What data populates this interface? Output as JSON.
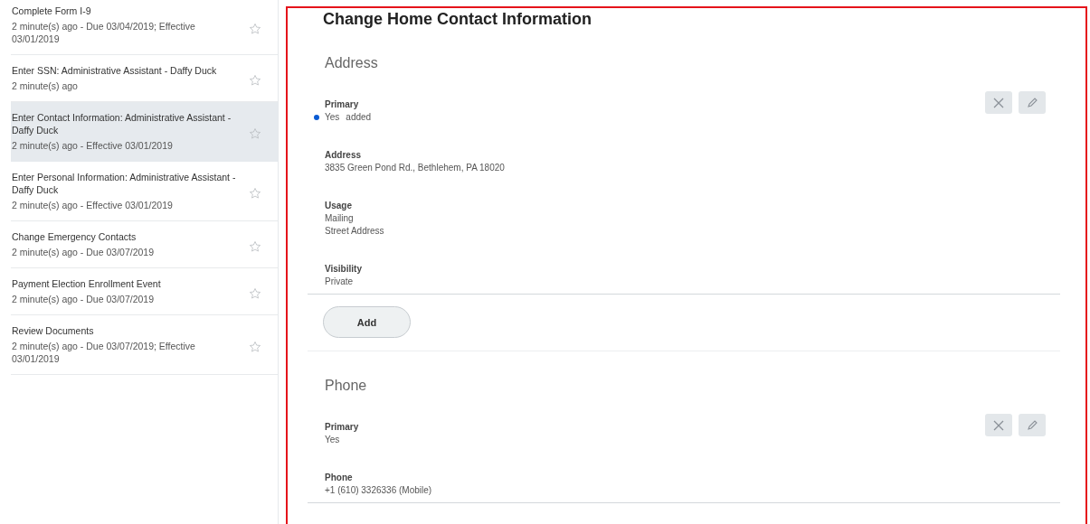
{
  "sidebar": {
    "items": [
      {
        "title": "Complete Form I-9",
        "subtitle": "2 minute(s) ago - Due 03/04/2019; Effective 03/01/2019",
        "selected": false
      },
      {
        "title": "Enter SSN: Administrative Assistant - Daffy Duck",
        "subtitle": "2 minute(s) ago",
        "selected": false
      },
      {
        "title": "Enter Contact Information: Administrative Assistant - Daffy Duck",
        "subtitle": "2 minute(s) ago - Effective 03/01/2019",
        "selected": true
      },
      {
        "title": "Enter Personal Information: Administrative Assistant - Daffy Duck",
        "subtitle": "2 minute(s) ago - Effective 03/01/2019",
        "selected": false
      },
      {
        "title": "Change Emergency Contacts",
        "subtitle": "2 minute(s) ago - Due 03/07/2019",
        "selected": false
      },
      {
        "title": "Payment Election Enrollment Event",
        "subtitle": "2 minute(s) ago - Due 03/07/2019",
        "selected": false
      },
      {
        "title": "Review Documents",
        "subtitle": "2 minute(s) ago - Due 03/07/2019; Effective 03/01/2019",
        "selected": false
      }
    ]
  },
  "main": {
    "title": "Change Home Contact Information",
    "sections": [
      {
        "heading": "Address",
        "fields": [
          {
            "label": "Primary",
            "values": [
              "Yes"
            ],
            "changed": true,
            "status": "added"
          },
          {
            "label": "Address",
            "values": [
              "3835 Green Pond Rd., Bethlehem, PA 18020"
            ],
            "changed": false
          },
          {
            "label": "Usage",
            "values": [
              "Mailing",
              "Street Address"
            ],
            "changed": false
          },
          {
            "label": "Visibility",
            "values": [
              "Private"
            ],
            "changed": false
          }
        ],
        "add_button": "Add"
      },
      {
        "heading": "Phone",
        "fields": [
          {
            "label": "Primary",
            "values": [
              "Yes"
            ],
            "changed": false
          },
          {
            "label": "Phone",
            "values": [
              "+1 (610) 3326336 (Mobile)"
            ],
            "changed": false
          }
        ]
      }
    ]
  }
}
